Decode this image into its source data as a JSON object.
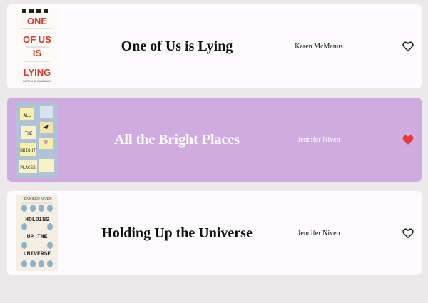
{
  "books": [
    {
      "title": "One of Us is Lying",
      "author": "Karen McManus",
      "favorited": false,
      "cover": {
        "lines": [
          "ONE",
          "OF US",
          "IS",
          "LYING"
        ],
        "author_line": "KAREN M. McMANUS"
      }
    },
    {
      "title": "All the Bright Places",
      "author": "Jennifer Niven",
      "favorited": true,
      "cover": {
        "lines": [
          "ALL",
          "THE",
          "BRIGHT",
          "PLACES"
        ]
      }
    },
    {
      "title": "Holding Up the Universe",
      "author": "Jennifer Niven",
      "favorited": false,
      "cover": {
        "author_line": "JENNIFER NIVEN",
        "lines": [
          "HOLDING",
          "UP THE",
          "UNIVERSE"
        ]
      }
    }
  ],
  "colors": {
    "page_background": "#ebe9ea",
    "card_background": "#fdfbfd",
    "selected_card_background": "#cfabdf",
    "heart_active": "#e5393a"
  },
  "icons": {
    "favorite": "heart-icon"
  }
}
